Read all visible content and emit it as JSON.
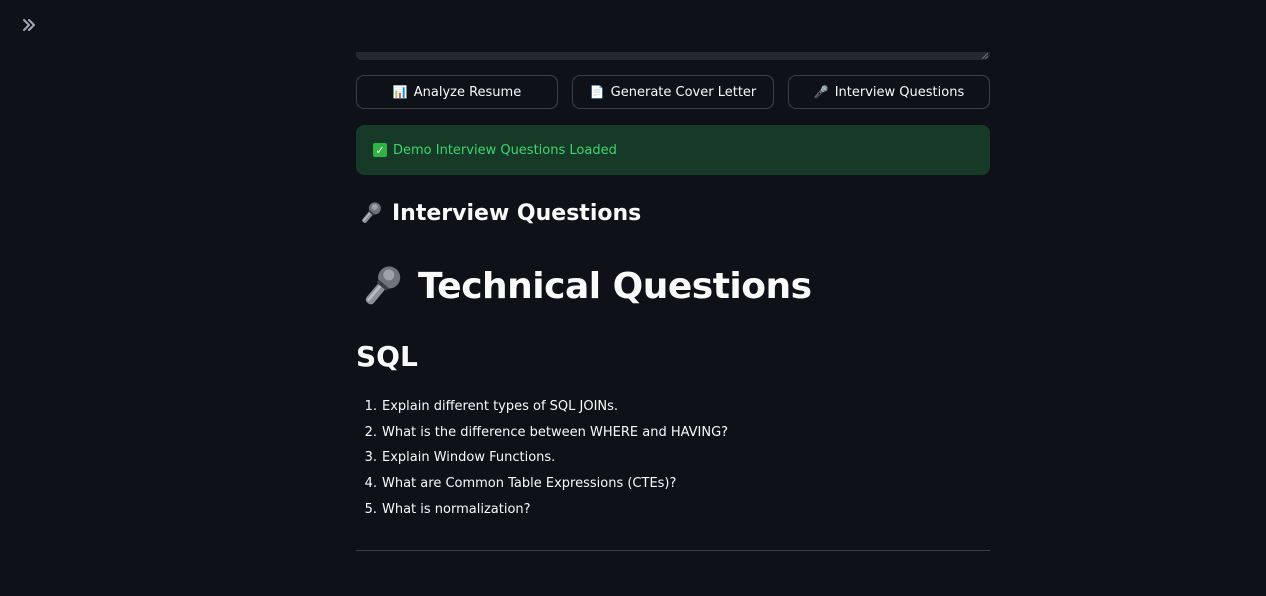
{
  "sidebar": {
    "toggle_icon": "double-chevron-right-icon"
  },
  "colors": {
    "background": "#0e1117",
    "button_border": "#4a4c55",
    "success_bg": "#173928",
    "success_text": "#3dd56d",
    "text": "#fafafa"
  },
  "actions": {
    "buttons": [
      {
        "icon": "📊",
        "icon_name": "bar-chart-icon",
        "label": "Analyze Resume"
      },
      {
        "icon": "📄",
        "icon_name": "document-icon",
        "label": "Generate Cover Letter"
      },
      {
        "icon": "🎤",
        "icon_name": "microphone-icon",
        "label": "Interview Questions"
      }
    ]
  },
  "alert": {
    "icon_name": "check-mark-icon",
    "text": "Demo Interview Questions Loaded"
  },
  "content": {
    "section_heading": "Interview Questions",
    "title": "Technical Questions",
    "subheading": "SQL",
    "questions": [
      {
        "num": "1.",
        "text": "Explain different types of SQL JOINs."
      },
      {
        "num": "2.",
        "text": "What is the difference between WHERE and HAVING?"
      },
      {
        "num": "3.",
        "text": "Explain Window Functions."
      },
      {
        "num": "4.",
        "text": "What are Common Table Expressions (CTEs)?"
      },
      {
        "num": "5.",
        "text": "What is normalization?"
      }
    ]
  }
}
